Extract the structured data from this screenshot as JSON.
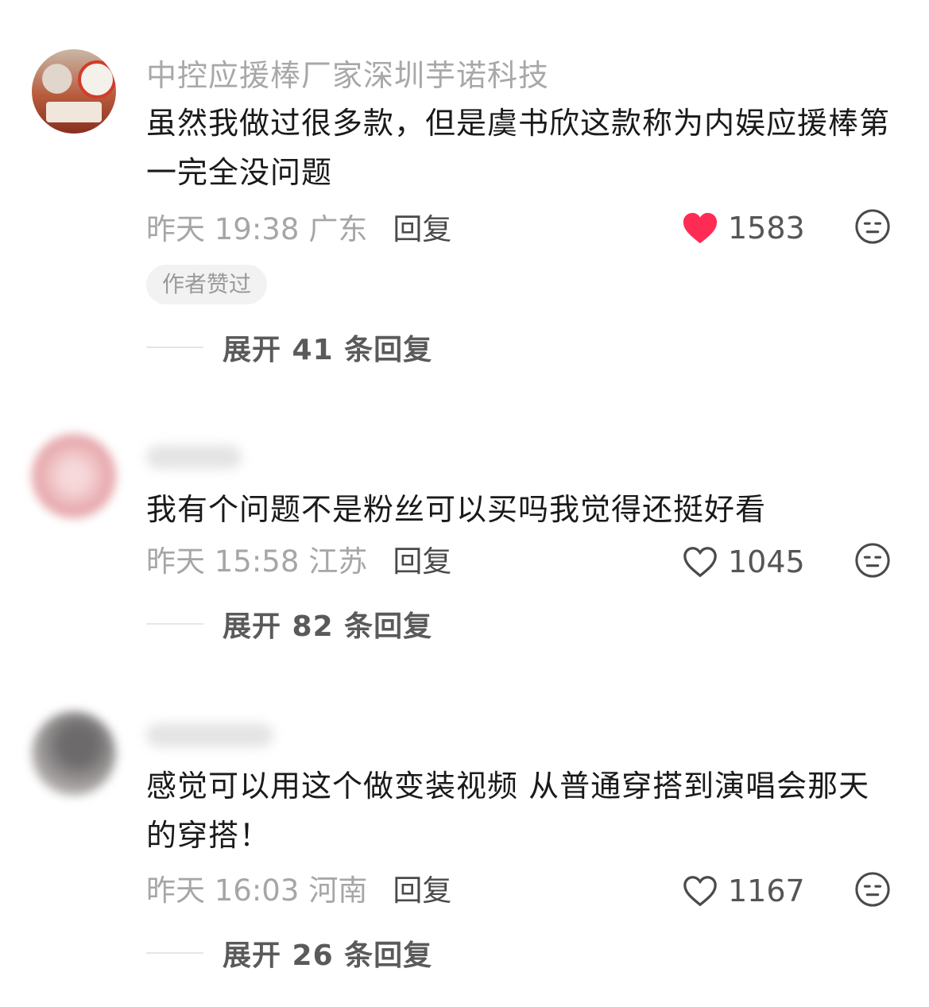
{
  "comments": [
    {
      "username": "中控应援棒厂家深圳芋诺科技",
      "content": "虽然我做过很多款，但是虞书欣这款称为内娱应援棒第一完全没问题",
      "time": "昨天 19:38",
      "location": "广东",
      "reply_label": "回复",
      "likes": "1583",
      "liked": true,
      "badge": "作者赞过",
      "expand_label": "展开 41 条回复"
    },
    {
      "username": "",
      "content": "我有个问题不是粉丝可以买吗我觉得还挺好看",
      "time": "昨天 15:58",
      "location": "江苏",
      "reply_label": "回复",
      "likes": "1045",
      "liked": false,
      "expand_label": "展开 82 条回复"
    },
    {
      "username": "",
      "content": "感觉可以用这个做变装视频 从普通穿搭到演唱会那天的穿搭！",
      "time": "昨天 16:03",
      "location": "河南",
      "reply_label": "回复",
      "likes": "1167",
      "liked": false,
      "expand_label": "展开 26 条回复"
    }
  ],
  "colors": {
    "like_active": "#fe2c55",
    "like_inactive": "#4a4a4a"
  },
  "icons": {
    "like": "heart-icon",
    "dislike": "unimpressed-face-icon"
  }
}
